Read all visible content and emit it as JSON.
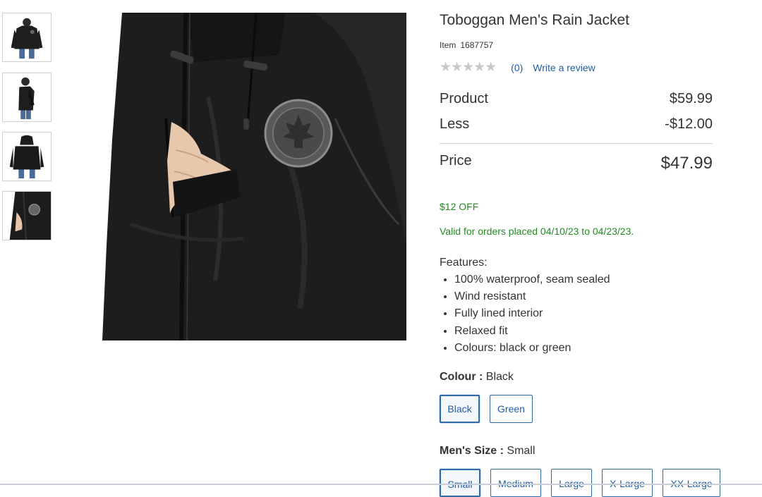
{
  "product": {
    "title": "Toboggan Men's Rain Jacket",
    "item_label": "Item",
    "item_number": "1687757",
    "rating_stars": "★★★★★",
    "review_count": "(0)",
    "write_review": "Write a review"
  },
  "pricing": {
    "rows": [
      {
        "label": "Product",
        "value": "$59.99"
      },
      {
        "label": "Less",
        "value": "-$12.00"
      },
      {
        "label": "Price",
        "value": "$47.99"
      }
    ]
  },
  "promo": {
    "off": "$12 OFF",
    "validity": "Valid for orders placed 04/10/23 to 04/23/23."
  },
  "features": {
    "heading": "Features:",
    "items": [
      "100% waterproof, seam sealed",
      "Wind resistant",
      "Fully lined interior",
      "Relaxed fit",
      "Colours: black or green"
    ]
  },
  "colour": {
    "label": "Colour :",
    "selected": "Black",
    "options": [
      "Black",
      "Green"
    ]
  },
  "size": {
    "label": "Men's Size :",
    "selected": "Small",
    "options": [
      "Small",
      "Medium",
      "Large",
      "X-Large",
      "XX-Large"
    ]
  },
  "colors": {
    "link": "#1f5ea8",
    "promo_green": "#228b22",
    "selected_border": "#2e6aa6",
    "stars_empty": "#c8c8c8"
  }
}
